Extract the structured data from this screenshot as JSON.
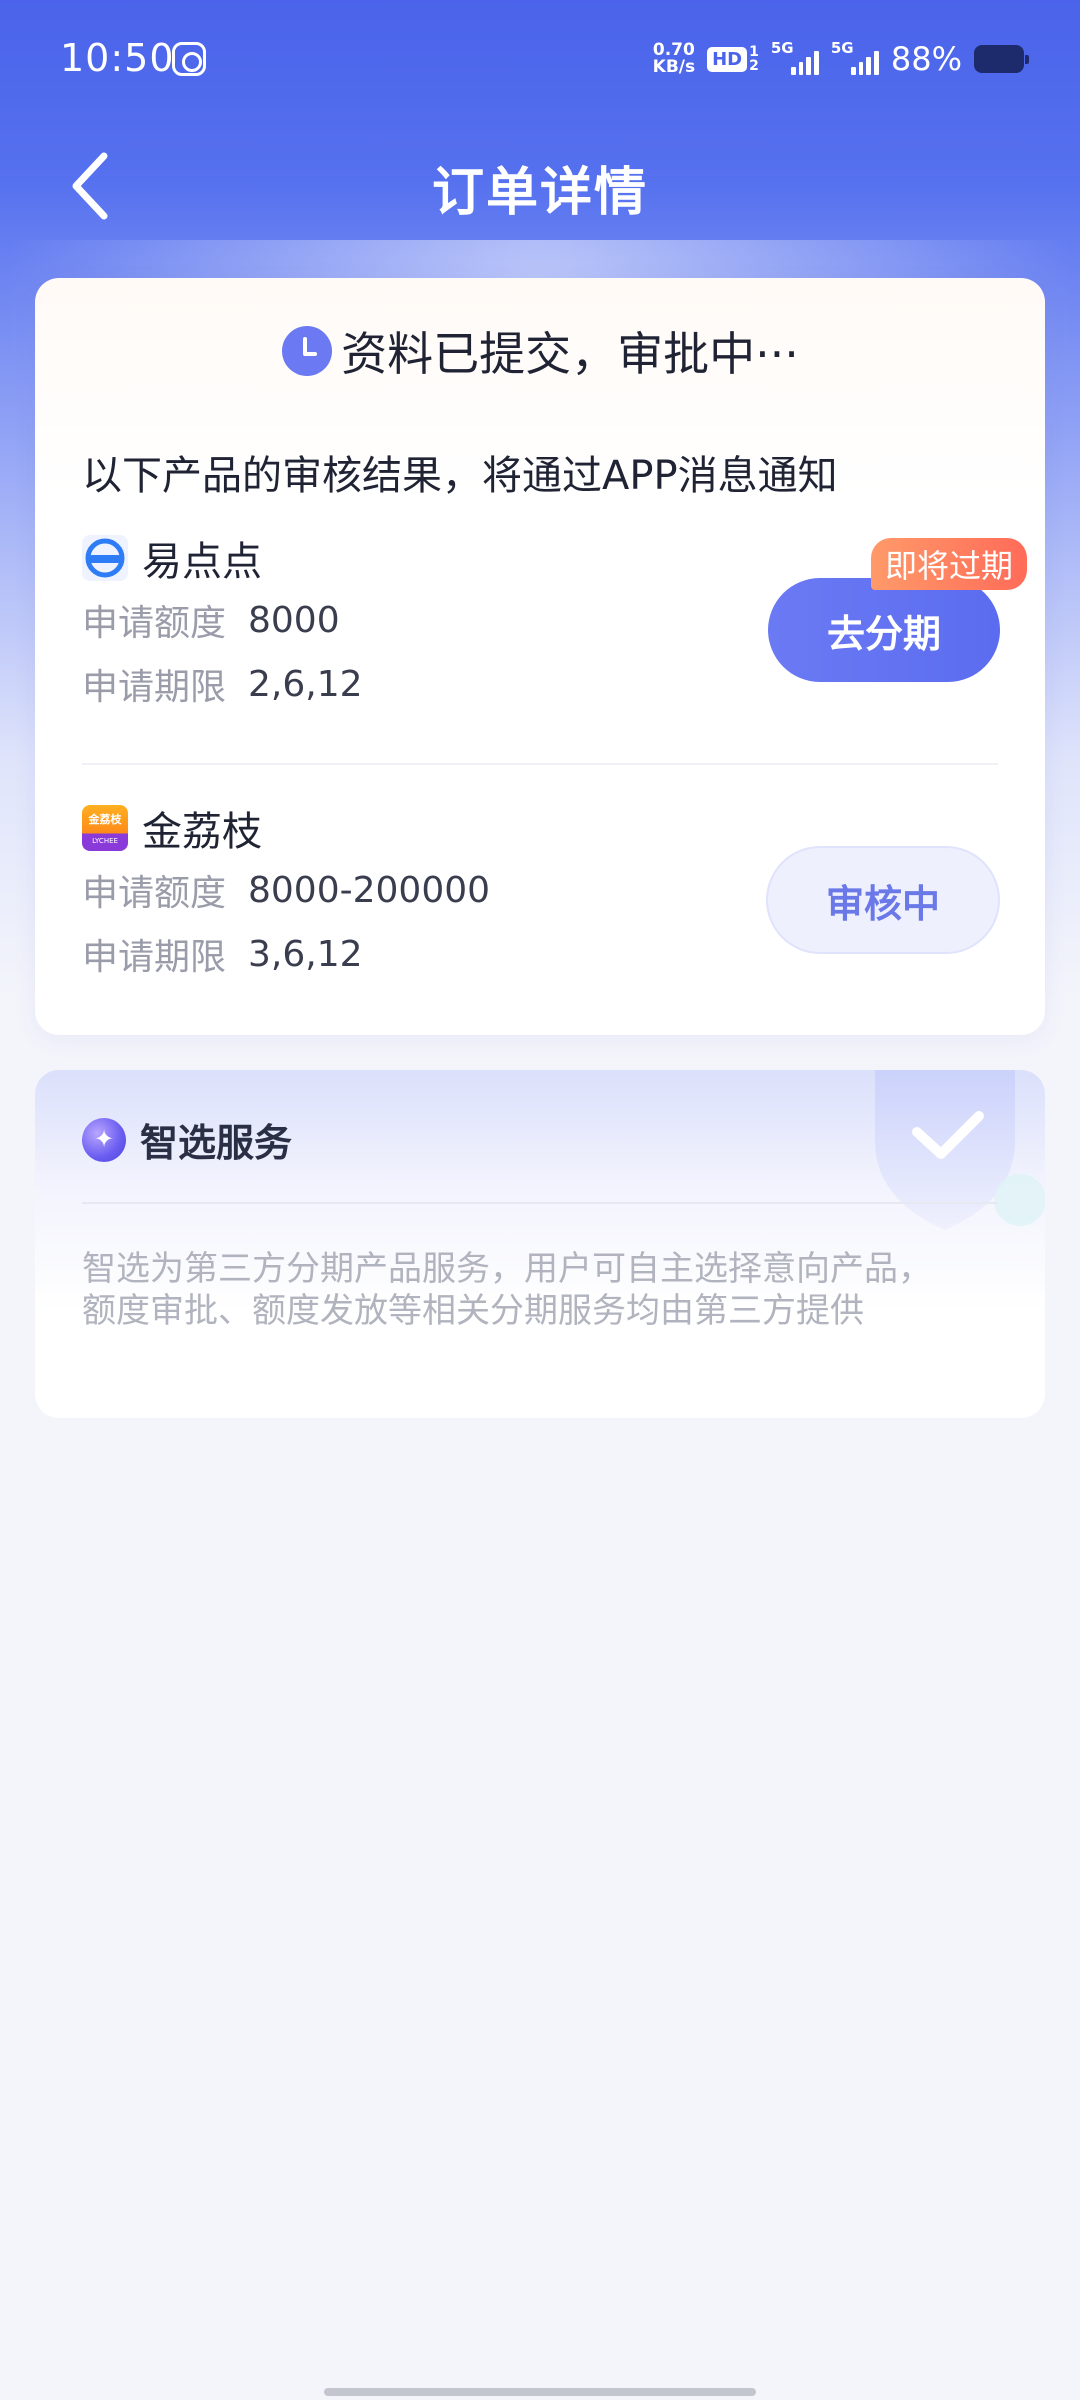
{
  "status_bar": {
    "time": "10:50",
    "net_speed_value": "0.70",
    "net_speed_unit": "KB/s",
    "hd_label": "HD",
    "hd_sub_top": "1",
    "hd_sub_bottom": "2",
    "sim1_label": "5G",
    "sim2_label": "5G",
    "battery": "88%"
  },
  "nav": {
    "title": "订单详情"
  },
  "order": {
    "status_text": "资料已提交，审批中···",
    "notice": "以下产品的审核结果，将通过APP消息通知",
    "products": [
      {
        "name": "易点点",
        "amount_label": "申请额度",
        "amount": "8000",
        "term_label": "申请期限",
        "term": "2,6,12",
        "button": "去分期",
        "tag": "即将过期",
        "logo_color": "#2f7df6"
      },
      {
        "name": "金荔枝",
        "amount_label": "申请额度",
        "amount": "8000-200000",
        "term_label": "申请期限",
        "term": "3,6,12",
        "button": "审核中",
        "logo_text": "金荔枝",
        "logo_sub": "LYCHEE"
      }
    ]
  },
  "service": {
    "title": "智选服务",
    "description": "智选为第三方分期产品服务，用户可自主选择意向产品，额度审批、额度发放等相关分期服务均由第三方提供"
  },
  "colors": {
    "primary": "#5b6cf0",
    "header_blue": "#4a63ea",
    "tag_orange": "#ff6b58"
  }
}
